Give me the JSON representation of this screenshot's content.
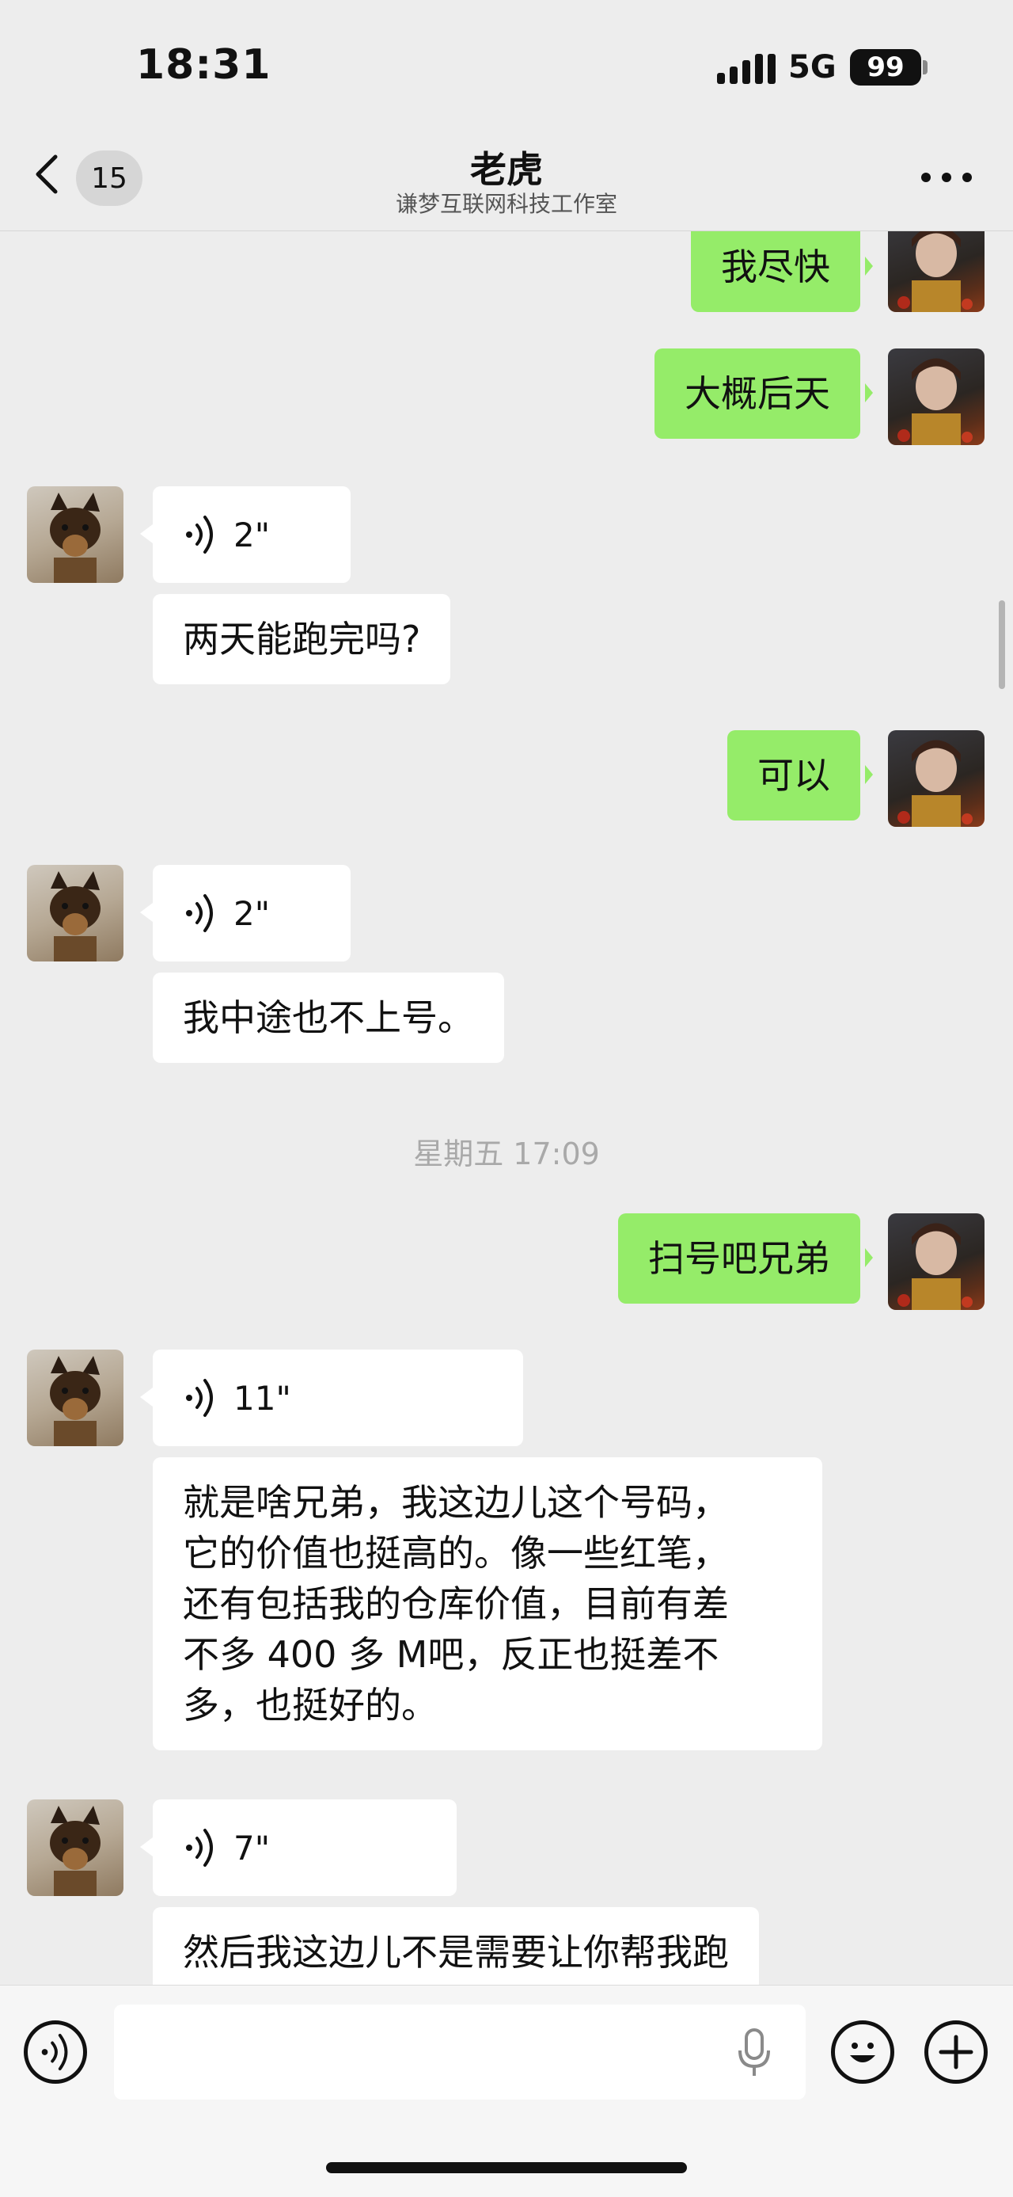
{
  "status_bar": {
    "time": "18:31",
    "network": "5G",
    "battery": "99"
  },
  "nav": {
    "unread_count": "15",
    "title": "老虎",
    "subtitle": "谦梦互联网科技工作室"
  },
  "messages": {
    "m1": "我尽快",
    "m2": "大概后天",
    "v1": "2\"",
    "m3": "两天能跑完吗?",
    "m4": "可以",
    "v2": "2\"",
    "m5": "我中途也不上号。",
    "ts": "星期五 17:09",
    "m6": "扫号吧兄弟",
    "v3": "11\"",
    "m7": "就是啥兄弟，我这边儿这个号码，\n它的价值也挺高的。像一些红笔，\n还有包括我的仓库价值，目前有差\n不多 400 多 M吧，反正也挺差不\n多，也挺好的。",
    "v4": "7\"",
    "m8": "然后我这边儿不是需要让你帮我跑"
  },
  "input": {
    "placeholder": ""
  },
  "colors": {
    "outgoing_bubble": "#95ec69",
    "incoming_bubble": "#ffffff",
    "background": "#ededed"
  },
  "icons": {
    "back": "chevron-left-icon",
    "more": "more-dots-icon",
    "voice": "voice-wave-icon",
    "mic": "microphone-icon",
    "emoji": "emoji-icon",
    "plus": "plus-icon"
  }
}
